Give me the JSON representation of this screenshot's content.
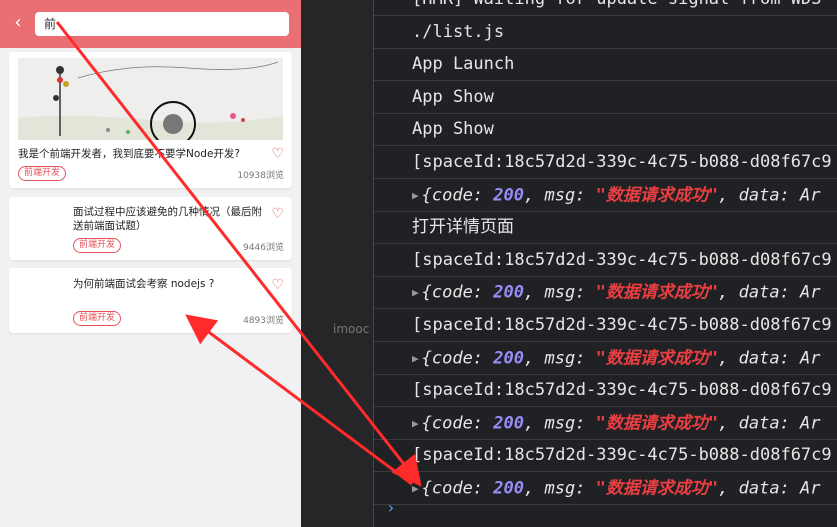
{
  "search": {
    "value": "前"
  },
  "cards": [
    {
      "title": "我是个前端开发者，我到底要不要学Node开发?",
      "tag": "前端开发",
      "views": "10938浏览"
    },
    {
      "title": "面试过程中应该避免的几种情况（最后附送前端面试题）",
      "tag": "前端开发",
      "views": "9446浏览"
    },
    {
      "title": "为何前端面试会考察 nodejs ?",
      "tag": "前端开发",
      "views": "4893浏览"
    }
  ],
  "console": {
    "lines": [
      {
        "text": "[HMR] Waiting for update signal from WDS"
      },
      {
        "text": "./list.js"
      },
      {
        "text": "App Launch"
      },
      {
        "text": "App Show"
      },
      {
        "text": "App Show"
      },
      {
        "text": "[spaceId:18c57d2d-339c-4c75-b088-d08f67c9"
      },
      {
        "obj": true
      },
      {
        "text": "打开详情页面"
      },
      {
        "text": "[spaceId:18c57d2d-339c-4c75-b088-d08f67c9"
      },
      {
        "obj": true
      },
      {
        "text": "[spaceId:18c57d2d-339c-4c75-b088-d08f67c9"
      },
      {
        "obj": true
      },
      {
        "text": "[spaceId:18c57d2d-339c-4c75-b088-d08f67c9"
      },
      {
        "obj": true
      },
      {
        "text": "[spaceId:18c57d2d-339c-4c75-b088-d08f67c9"
      },
      {
        "obj": true
      }
    ],
    "obj_parts": {
      "open": "{",
      "code_key": "code",
      "code_val": "200",
      "msg_key": "msg",
      "msg_val": "\"数据请求成功\"",
      "data_key": "data",
      "data_tail": "Ar"
    },
    "prompt": "›"
  },
  "watermark": "imooc",
  "colors": {
    "nav": "#ea6f73",
    "accent": "#e4535a",
    "arrow": "#ff2a2a"
  }
}
